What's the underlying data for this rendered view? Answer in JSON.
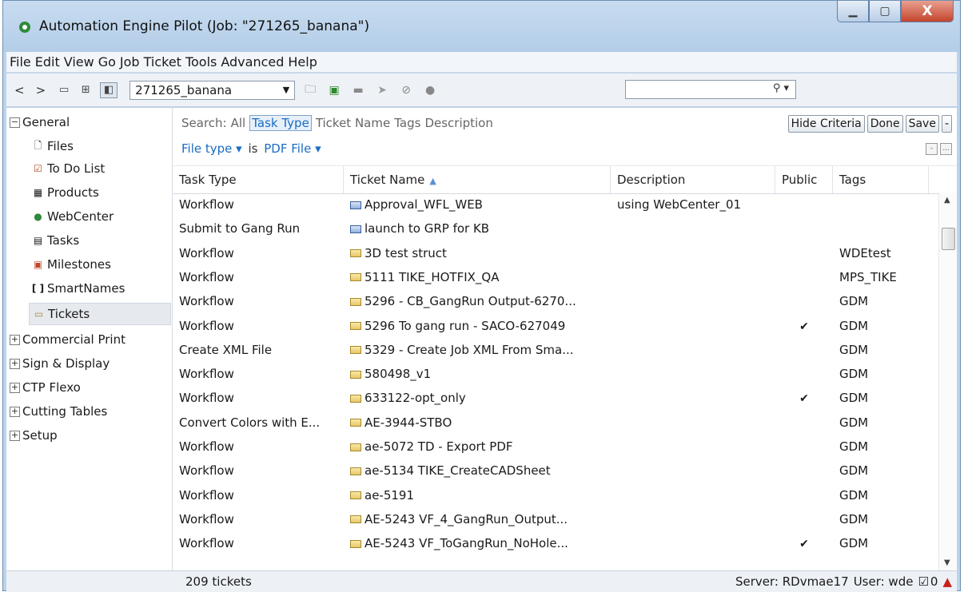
{
  "window": {
    "title": "Automation Engine Pilot (Job: \"271265_banana\")",
    "controls": {
      "minimize": "▁",
      "maximize": "▢",
      "close": "X"
    }
  },
  "menu": [
    "File",
    "Edit",
    "View",
    "Go",
    "Job",
    "Ticket",
    "Tools",
    "Advanced",
    "Help"
  ],
  "toolbar": {
    "back": "<",
    "forward": ">",
    "job_value": "271265_banana",
    "search_value": ""
  },
  "sidebar": {
    "general": "General",
    "items": [
      {
        "label": "Files",
        "icon": "file-icon",
        "glyph": "🗋"
      },
      {
        "label": "To Do List",
        "icon": "todo-icon",
        "glyph": "☑"
      },
      {
        "label": "Products",
        "icon": "products-icon",
        "glyph": "▦"
      },
      {
        "label": "WebCenter",
        "icon": "webcenter-icon",
        "glyph": "●"
      },
      {
        "label": "Tasks",
        "icon": "tasks-icon",
        "glyph": "▤"
      },
      {
        "label": "Milestones",
        "icon": "milestones-icon",
        "glyph": "▣"
      },
      {
        "label": "SmartNames",
        "icon": "smartnames-icon",
        "glyph": "[ ]"
      },
      {
        "label": "Tickets",
        "icon": "tickets-icon",
        "glyph": "▭"
      }
    ],
    "groups": [
      "Commercial Print",
      "Sign & Display",
      "CTP Flexo",
      "Cutting Tables",
      "Setup"
    ]
  },
  "criteria": {
    "search_label": "Search:",
    "options": [
      "All",
      "Task Type",
      "Ticket Name",
      "Tags",
      "Description"
    ],
    "selected": "Task Type",
    "filter_field": "File type ▾",
    "filter_op": "is",
    "filter_value": "PDF File ▾",
    "buttons": {
      "hide": "Hide Criteria",
      "done": "Done",
      "save": "Save",
      "minus": "-"
    },
    "mini": {
      "minus": "-",
      "more": "..."
    }
  },
  "table": {
    "headers": {
      "task_type": "Task Type",
      "ticket_name": "Ticket Name",
      "sort_indicator": "▲",
      "description": "Description",
      "public": "Public",
      "tags": "Tags"
    },
    "rows": [
      {
        "task_type": "Workflow",
        "ticket_name": "Approval_WFL_WEB",
        "icon": "blue",
        "description": "using WebCenter_01",
        "public": "",
        "tags": ""
      },
      {
        "task_type": "Submit to Gang Run",
        "ticket_name": "launch to GRP for KB",
        "icon": "blue",
        "description": "",
        "public": "",
        "tags": ""
      },
      {
        "task_type": "Workflow",
        "ticket_name": "3D test struct",
        "icon": "yellow",
        "description": "",
        "public": "",
        "tags": "WDEtest"
      },
      {
        "task_type": "Workflow",
        "ticket_name": "5111 TIKE_HOTFIX_QA",
        "icon": "yellow",
        "description": "",
        "public": "",
        "tags": "MPS_TIKE"
      },
      {
        "task_type": "Workflow",
        "ticket_name": "5296 - CB_GangRun Output-6270...",
        "icon": "yellow",
        "description": "",
        "public": "",
        "tags": "GDM"
      },
      {
        "task_type": "Workflow",
        "ticket_name": "5296 To gang run - SACO-627049",
        "icon": "yellow",
        "description": "",
        "public": "✔",
        "tags": "GDM"
      },
      {
        "task_type": "Create XML File",
        "ticket_name": "5329 - Create Job XML From Sma...",
        "icon": "yellow",
        "description": "",
        "public": "",
        "tags": "GDM"
      },
      {
        "task_type": "Workflow",
        "ticket_name": "580498_v1",
        "icon": "yellow",
        "description": "",
        "public": "",
        "tags": "GDM"
      },
      {
        "task_type": "Workflow",
        "ticket_name": "633122-opt_only",
        "icon": "yellow",
        "description": "",
        "public": "✔",
        "tags": "GDM"
      },
      {
        "task_type": "Convert Colors with E...",
        "ticket_name": "AE-3944-STBO",
        "icon": "yellow",
        "description": "",
        "public": "",
        "tags": "GDM"
      },
      {
        "task_type": "Workflow",
        "ticket_name": "ae-5072 TD - Export PDF",
        "icon": "yellow",
        "description": "",
        "public": "",
        "tags": "GDM"
      },
      {
        "task_type": "Workflow",
        "ticket_name": "ae-5134 TIKE_CreateCADSheet",
        "icon": "yellow",
        "description": "",
        "public": "",
        "tags": "GDM"
      },
      {
        "task_type": "Workflow",
        "ticket_name": "ae-5191",
        "icon": "yellow",
        "description": "",
        "public": "",
        "tags": "GDM"
      },
      {
        "task_type": "Workflow",
        "ticket_name": "AE-5243 VF_4_GangRun_Output...",
        "icon": "yellow",
        "description": "",
        "public": "",
        "tags": "GDM"
      },
      {
        "task_type": "Workflow",
        "ticket_name": "AE-5243 VF_ToGangRun_NoHole...",
        "icon": "yellow",
        "description": "",
        "public": "✔",
        "tags": "GDM"
      }
    ]
  },
  "status": {
    "count": "209 tickets",
    "server": "Server: RDvmae17",
    "user": "User: wde",
    "todo_count": "0"
  },
  "colors": {
    "accent": "#1a6dc4",
    "titlebar": "#bcd4ec"
  }
}
